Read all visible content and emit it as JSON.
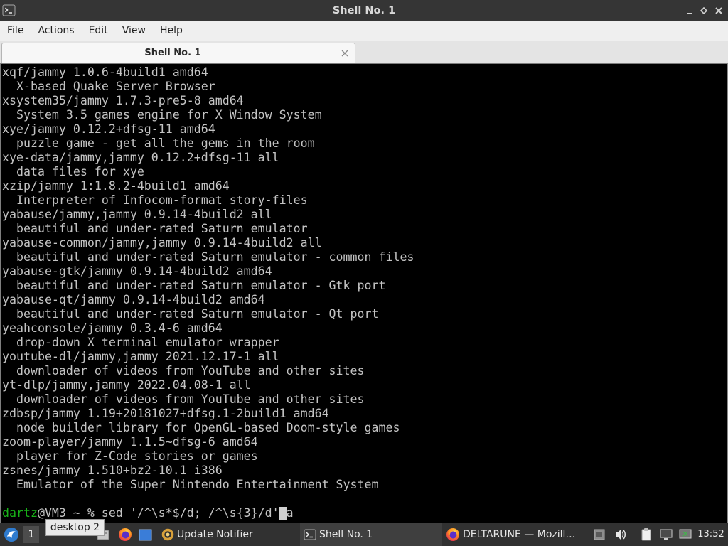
{
  "window": {
    "title": "Shell No. 1",
    "icon": "terminal-icon"
  },
  "menu": [
    "File",
    "Actions",
    "Edit",
    "View",
    "Help"
  ],
  "tabs": [
    {
      "label": "Shell No. 1",
      "active": true
    }
  ],
  "terminal": {
    "colors": {
      "background": "#000000",
      "foreground": "#c3c3c3",
      "prompt_user": "#18b218",
      "cursor": "#d0d0d0"
    },
    "lines": [
      "xqf/jammy 1.0.6-4build1 amd64",
      "  X-based Quake Server Browser",
      "xsystem35/jammy 1.7.3-pre5-8 amd64",
      "  System 3.5 games engine for X Window System",
      "xye/jammy 0.12.2+dfsg-11 amd64",
      "  puzzle game - get all the gems in the room",
      "xye-data/jammy,jammy 0.12.2+dfsg-11 all",
      "  data files for xye",
      "xzip/jammy 1:1.8.2-4build1 amd64",
      "  Interpreter of Infocom-format story-files",
      "yabause/jammy,jammy 0.9.14-4build2 all",
      "  beautiful and under-rated Saturn emulator",
      "yabause-common/jammy,jammy 0.9.14-4build2 all",
      "  beautiful and under-rated Saturn emulator - common files",
      "yabause-gtk/jammy 0.9.14-4build2 amd64",
      "  beautiful and under-rated Saturn emulator - Gtk port",
      "yabause-qt/jammy 0.9.14-4build2 amd64",
      "  beautiful and under-rated Saturn emulator - Qt port",
      "yeahconsole/jammy 0.3.4-6 amd64",
      "  drop-down X terminal emulator wrapper",
      "youtube-dl/jammy,jammy 2021.12.17-1 all",
      "  downloader of videos from YouTube and other sites",
      "yt-dlp/jammy,jammy 2022.04.08-1 all",
      "  downloader of videos from YouTube and other sites",
      "zdbsp/jammy 1.19+20181027+dfsg.1-2build1 amd64",
      "  node builder library for OpenGL-based Doom-style games",
      "zoom-player/jammy 1.1.5~dfsg-6 amd64",
      "  player for Z-Code stories or games",
      "zsnes/jammy 1.510+bz2-10.1 i386",
      "  Emulator of the Super Nintendo Entertainment System"
    ],
    "prompt": {
      "user": "dartz",
      "host": "@VM3 ~ % ",
      "command": "sed '/^\\s*$/d; /^\\s{3}/d'",
      "after_cursor": "a"
    }
  },
  "taskbar": {
    "start_icon": "lxqt-menu-icon",
    "desktop_button": "1",
    "tooltip": "desktop 2",
    "quicklaunch": [
      "file-manager-icon",
      "firefox-icon",
      "show-desktop-icon"
    ],
    "tasks": [
      {
        "label": "Update Notifier",
        "icon": "update-notifier-icon",
        "active": false
      },
      {
        "label": "Shell No. 1",
        "icon": "terminal-icon",
        "active": true
      },
      {
        "label": "DELTARUNE — Mozill…",
        "icon": "firefox-icon",
        "active": false
      }
    ],
    "tray": [
      "window-list-icon",
      "volume-icon",
      "clipboard-icon",
      "network-icon",
      "display-icon"
    ],
    "clock": "13:52"
  }
}
